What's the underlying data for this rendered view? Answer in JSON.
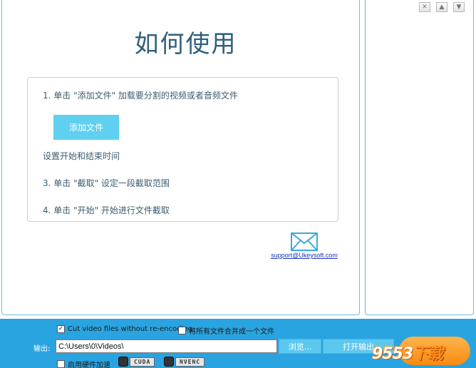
{
  "main": {
    "title": "如何使用",
    "steps": {
      "step1": "1. 单击 \"添加文件\" 加载要分割的视频或者音频文件",
      "add_file_button": "添加文件",
      "step2": "设置开始和结束时间",
      "step3": "3. 单击 \"截取\" 设定一段截取范围",
      "step4": "4. 单击 \"开始\" 开始进行文件截取"
    },
    "support_email": "support@Ukeysoft.com"
  },
  "window_buttons": {
    "close": "✕",
    "up": "▲",
    "down": "▼"
  },
  "bottom": {
    "cut_without_reencoding": {
      "label": "Cut video files without re-encoding",
      "checked": true,
      "mark": "✓"
    },
    "merge_all": {
      "label": "将所有文件合并成一个文件",
      "checked": false
    },
    "output_label": "输出:",
    "output_path": "C:\\Users\\0\\Videos\\",
    "browse_button": "浏览...",
    "open_output_button": "打开输出",
    "hw_accel": {
      "label": "启用硬件加速",
      "checked": false
    },
    "gpu_badges": [
      "CUDA",
      "NVENC"
    ]
  },
  "watermark": {
    "part1": "9553",
    "part2": "下载"
  },
  "colors": {
    "accent": "#2aa4e0",
    "button": "#5fd0ef",
    "start": "#f78a12"
  }
}
